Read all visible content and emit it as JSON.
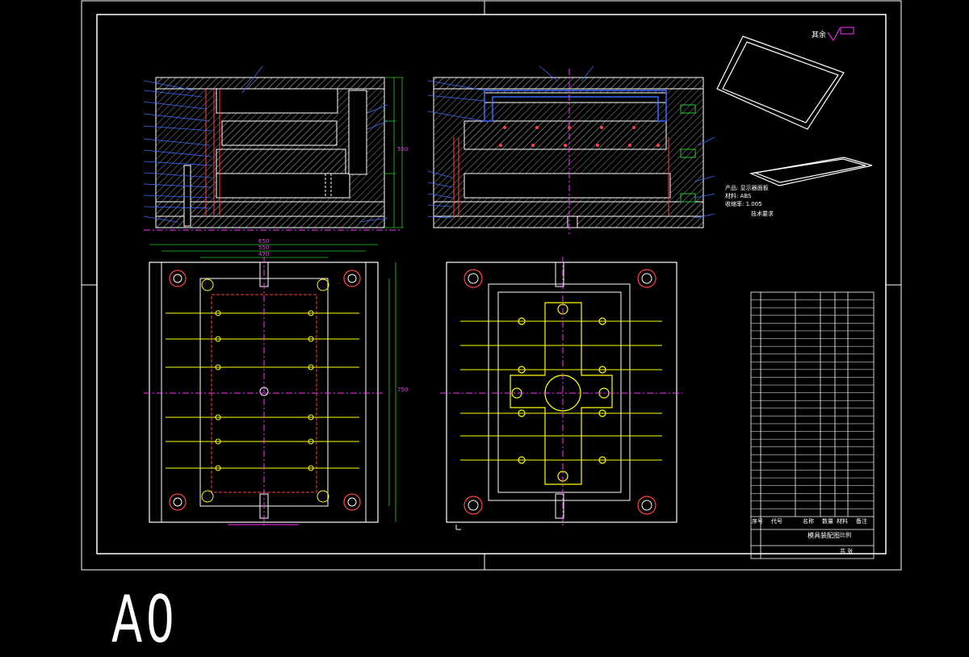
{
  "sheet": {
    "size_label": "A0",
    "background": "#000000",
    "border_color": "#ffffff"
  },
  "colors": {
    "outline": "#ffffff",
    "hatch": "#8a8a8a",
    "cooling": "#ffff00",
    "center_line": "#ff33ff",
    "leader": "#3a6bff",
    "dimension": "#22cc22",
    "pins": "#ff4040",
    "ejector": "#00e5ff"
  },
  "views": [
    {
      "name": "front-section",
      "kind": "section"
    },
    {
      "name": "side-section",
      "kind": "section"
    },
    {
      "name": "top-plan",
      "kind": "plan"
    },
    {
      "name": "bottom-plan",
      "kind": "plan"
    }
  ],
  "dimensions": {
    "width_overall": "650",
    "width_mid": "550",
    "width_inner": "470",
    "height_overall": "550",
    "height_inner": "750"
  },
  "roughness_note": "其余",
  "tech_requirements_title": "技术要求",
  "product_info": [
    "产品: 显示器面板",
    "材料: ABS",
    "收缩率: 1.005"
  ],
  "bom_headers": [
    "序号",
    "代号",
    "名称",
    "数量",
    "材料",
    "备注"
  ],
  "title_block": {
    "drawing_title": "模具装配图",
    "scale_label": "比例",
    "sheet_label": "共 张"
  },
  "icons": [
    "product-isometric-icon",
    "roughness-symbol-icon"
  ]
}
